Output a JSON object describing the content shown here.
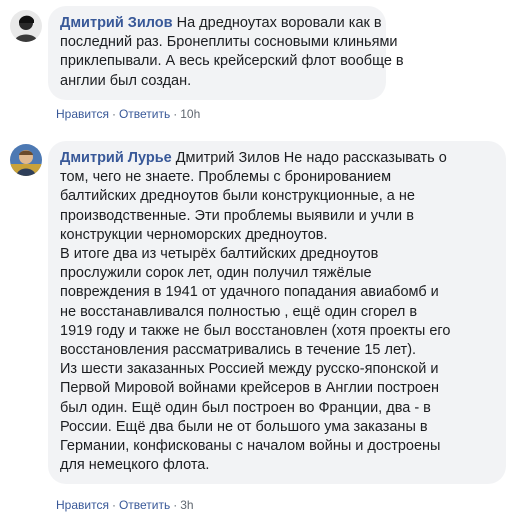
{
  "comments": [
    {
      "author": "Дмитрий Зилов",
      "lines": [
        "На дредноутах воровали как в",
        "последний раз. Бронеплиты сосновыми клиньями",
        "приклепывали. А весь крейсерский флот вообще в",
        "англии был создан."
      ],
      "actions": {
        "like": "Нравится",
        "reply": "Ответить",
        "time": "10h"
      }
    },
    {
      "author": "Дмитрий Лурье",
      "lines": [
        "Дмитрий Зилов Не надо рассказывать о",
        "том, чего не знаете. Проблемы с бронированием",
        "балтийских дредноутов были конструкционные, а не",
        "производственные. Эти проблемы выявили и учли в",
        "конструкции черноморских дредноутов.",
        "В итоге два из четырёх балтийских дредноутов",
        "прослужили сорок лет, один получил тяжёлые",
        "повреждения в 1941 от удачного попадания авиабомб и",
        "не восстанавливался полностью , ещё один сгорел в",
        "1919 году и также не был восстановлен (хотя проекты его",
        "восстановления рассматривались в течение 15 лет).",
        "Из шести заказанных Россией между русско-японской и",
        "Первой Мировой войнами крейсеров в Англии построен",
        "был один. Ещё один был построен во Франции, два - в",
        "России. Ещё два были не от большого ума заказаны в",
        "Германии, конфискованы с началом войны и достроены",
        "для немецкого флота."
      ],
      "actions": {
        "like": "Нравится",
        "reply": "Ответить",
        "time": "3h"
      }
    }
  ],
  "separator": "·",
  "colors": {
    "author": "#385898",
    "bubble": "#f2f3f5",
    "meta": "#606770"
  }
}
